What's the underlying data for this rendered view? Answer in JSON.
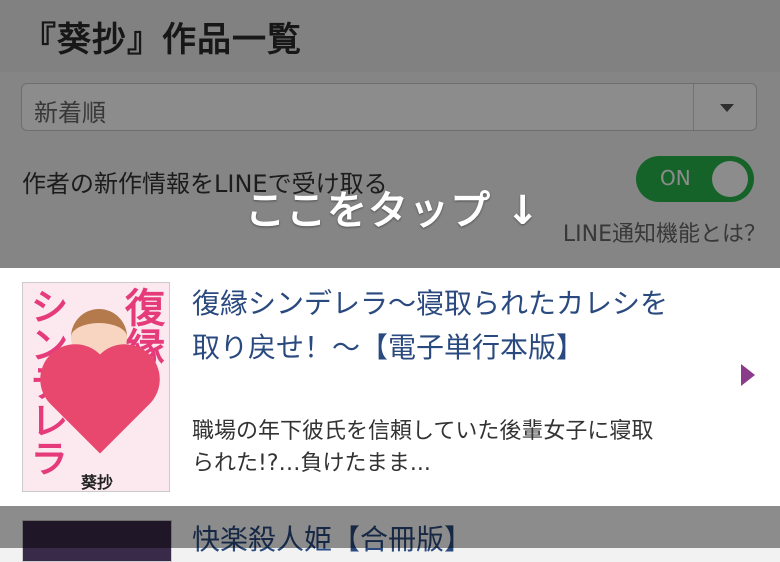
{
  "header": {
    "title": "『葵抄』作品一覧"
  },
  "sort": {
    "selected": "新着順"
  },
  "notify": {
    "label": "作者の新作情報をLINEで受け取る",
    "toggle": "ON",
    "help_link": "LINE通知機能とは？"
  },
  "overlay": {
    "hint": "ここをタップ ↓"
  },
  "works": [
    {
      "title": "復縁シンデレラ〜寝取られたカレシを取り戻せ！〜【電子単行本版】",
      "description": "職場の年下彼氏を信頼していた後輩女子に寝取られた!?…負けたまま...",
      "cover_text_1": "復縁",
      "cover_text_2": "シンデレラ",
      "cover_author": "葵抄"
    },
    {
      "title": "快楽殺人姫【合冊版】"
    }
  ],
  "colors": {
    "toggle_on": "#29b54b",
    "title_link": "#2a4a7f",
    "arrow": "#8a3b8a"
  }
}
